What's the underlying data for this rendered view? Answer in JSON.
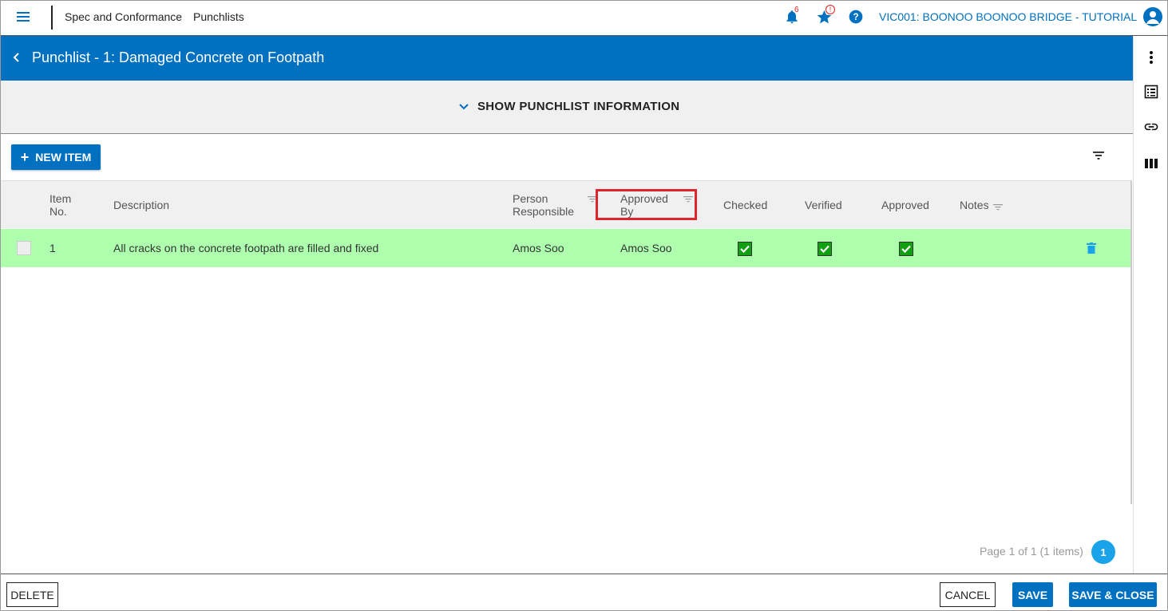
{
  "topbar": {
    "module": "Spec and Conformance",
    "page": "Punchlists",
    "notifications_count": "6",
    "favorites_badge": "!",
    "project": "VIC001: BOONOO BOONOO BRIDGE - TUTORIAL"
  },
  "header": {
    "title": "Punchlist - 1: Damaged Concrete on Footpath"
  },
  "info_toggle": "SHOW PUNCHLIST INFORMATION",
  "toolbar": {
    "new_item": "NEW ITEM"
  },
  "grid": {
    "columns": {
      "item_no_1": "Item",
      "item_no_2": "No.",
      "description": "Description",
      "person_1": "Person",
      "person_2": "Responsible",
      "approved_by_1": "Approved",
      "approved_by_2": "By",
      "checked": "Checked",
      "verified": "Verified",
      "approved": "Approved",
      "notes": "Notes"
    },
    "rows": [
      {
        "item_no": "1",
        "description": "All cracks on the concrete footpath are filled and fixed",
        "person_responsible": "Amos Soo",
        "approved_by": "Amos Soo",
        "checked": true,
        "verified": true,
        "approved": true,
        "notes": ""
      }
    ]
  },
  "pager": {
    "info": "Page 1 of 1 (1 items)",
    "current": "1"
  },
  "footer": {
    "delete": "DELETE",
    "cancel": "CANCEL",
    "save": "SAVE",
    "save_close": "SAVE & CLOSE"
  },
  "colors": {
    "brand": "#0070c0",
    "row_highlight": "#aeffae",
    "check_green": "#11a011",
    "annotation_red": "#e0242b"
  }
}
